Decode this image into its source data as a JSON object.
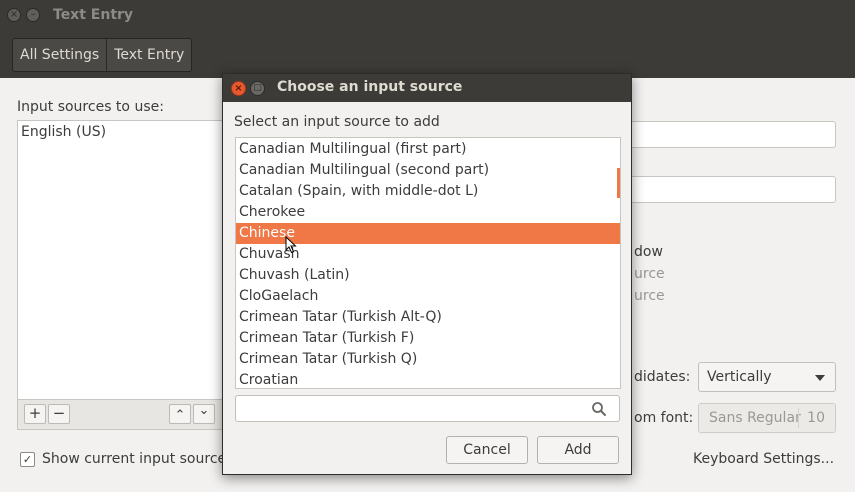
{
  "window": {
    "title": "Text Entry",
    "close_glyph": "×",
    "minimize_glyph": "–"
  },
  "breadcrumb": {
    "all_settings": "All Settings",
    "current": "Text Entry"
  },
  "main": {
    "sources_label": "Input sources to use:",
    "sources": [
      "English (US)"
    ],
    "add_glyph": "+",
    "remove_glyph": "−",
    "up_glyph": "⌃",
    "down_glyph": "⌄",
    "show_current_label": "Show current input source",
    "show_current_checked": true,
    "partial_labels": {
      "window": "dow",
      "source1": "urce",
      "source2": "urce",
      "candidates": "didates:",
      "custom_font": "om font:"
    },
    "candidates_value": "Vertically",
    "font_name": "Sans Regular",
    "font_size": "10",
    "keyboard_settings": "Keyboard Settings..."
  },
  "dialog": {
    "title": "Choose an input source",
    "prompt": "Select an input source to add",
    "items": [
      "Canadian Multilingual (first part)",
      "Canadian Multilingual (second part)",
      "Catalan (Spain, with middle-dot L)",
      "Cherokee",
      "Chinese",
      "Chuvash",
      "Chuvash (Latin)",
      "CloGaelach",
      "Crimean Tatar (Turkish Alt-Q)",
      "Crimean Tatar (Turkish F)",
      "Crimean Tatar (Turkish Q)",
      "Croatian"
    ],
    "selected": "Chinese",
    "search_value": "",
    "cancel_label": "Cancel",
    "add_label": "Add"
  },
  "colors": {
    "accent": "#f07746",
    "titlebar": "#3c3b37",
    "background": "#f2f1f0"
  },
  "icons": {
    "search": "search-icon",
    "close": "close-icon",
    "maximize": "maximize-icon",
    "cursor": "mouse-cursor-icon"
  }
}
